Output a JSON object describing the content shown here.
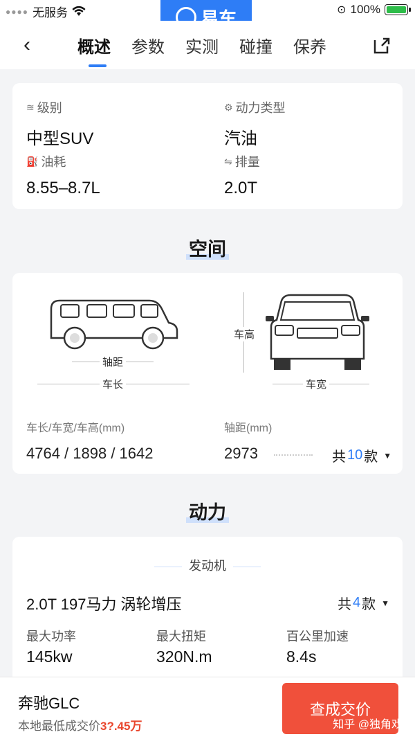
{
  "status": {
    "carrier": "无服务",
    "battery": "100%",
    "battery_level": 1.0
  },
  "brand": {
    "name": "易车"
  },
  "nav": {
    "tabs": [
      "概述",
      "参数",
      "实测",
      "碰撞",
      "保养"
    ]
  },
  "basic": {
    "level_label": "级别",
    "level_value": "中型SUV",
    "power_type_label": "动力类型",
    "power_type_value": "汽油",
    "fuel_label": "油耗",
    "fuel_value": "8.55–8.7L",
    "displacement_label": "排量",
    "displacement_value": "2.0T"
  },
  "space": {
    "title": "空间",
    "wheelbase_label": "轴距",
    "length_label": "车长",
    "height_label": "车高",
    "width_label": "车宽",
    "dims_label": "车长/车宽/车高(mm)",
    "dims_value": "4764 / 1898 / 1642",
    "wheelbase_mm_label": "轴距(mm)",
    "wheelbase_value": "2973",
    "count_prefix": "共",
    "count_num": "10",
    "count_suffix": "款"
  },
  "power": {
    "title": "动力",
    "engine_head": "发动机",
    "engine_name": "2.0T 197马力 涡轮增压",
    "count_prefix": "共",
    "count_num": "4",
    "count_suffix": "款",
    "max_power_label": "最大功率",
    "max_power_value": "145kw",
    "max_torque_label": "最大扭矩",
    "max_torque_value": "320N.m",
    "accel_label": "百公里加速",
    "accel_value": "8.4s"
  },
  "bottom": {
    "model": "奔驰GLC",
    "price_label": "本地最低成交价",
    "price_value": "3?.45万",
    "cta": "查成交价",
    "watermark": "知乎 @独角戏"
  }
}
